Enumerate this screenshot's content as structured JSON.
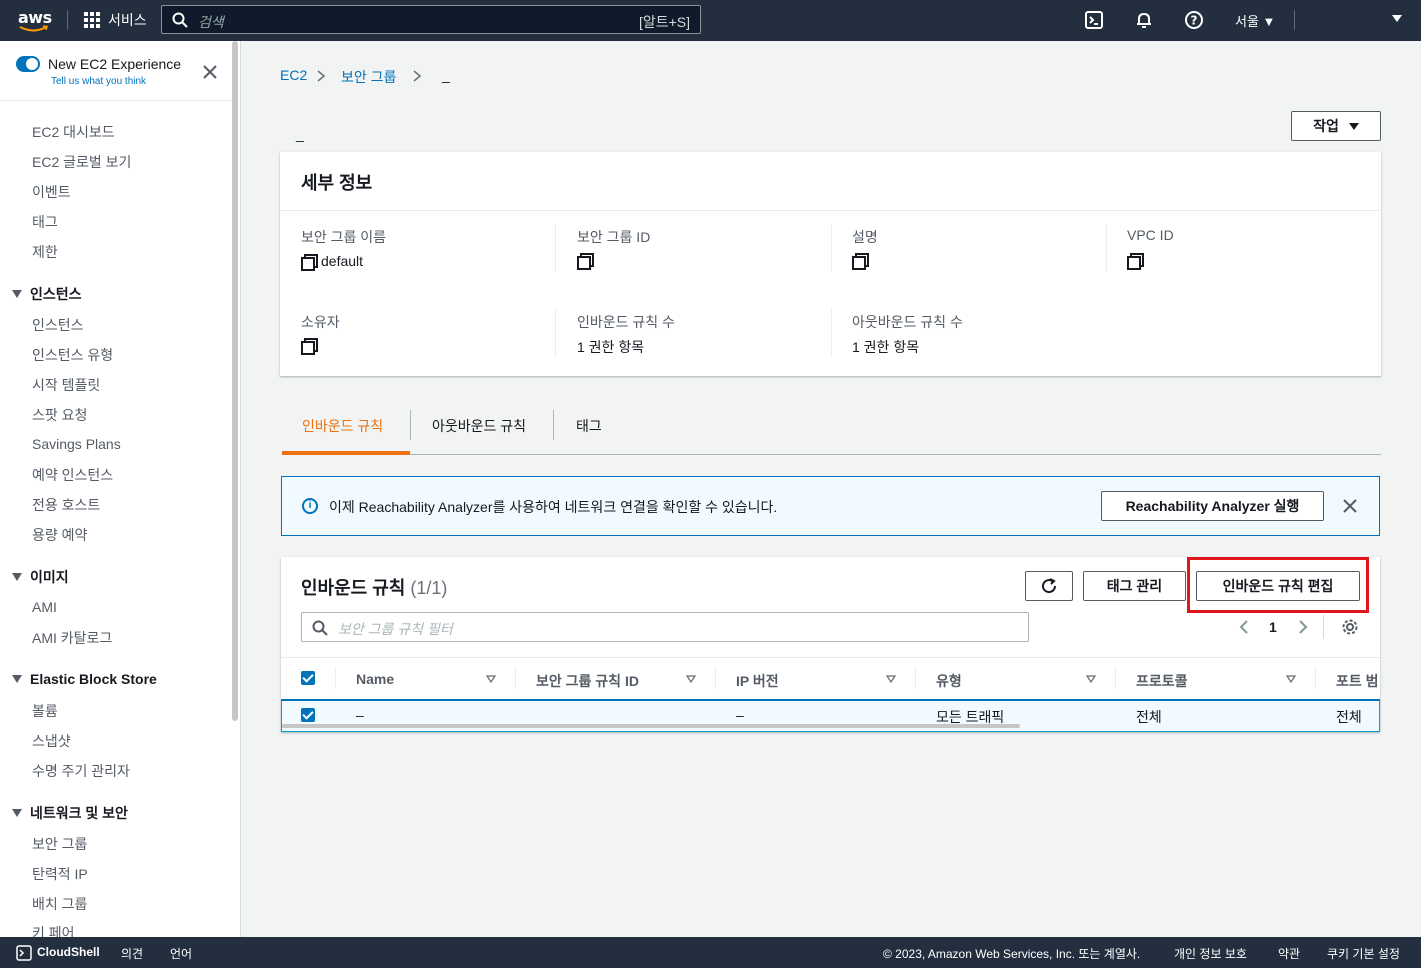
{
  "topnav": {
    "logo_text": "aws",
    "services_label": "서비스",
    "search_placeholder": "검색",
    "search_shortcut": "[알트+S]",
    "region": "서울",
    "colors": {
      "bg": "#232f3e",
      "accent": "#ec7211",
      "link": "#0073bb"
    }
  },
  "sidebar": {
    "experience_title": "New EC2 Experience",
    "experience_sub": "Tell us what you think",
    "top_items": [
      "EC2 대시보드",
      "EC2 글로벌 보기",
      "이벤트",
      "태그",
      "제한"
    ],
    "sections": [
      {
        "title": "인스턴스",
        "items": [
          "인스턴스",
          "인스턴스 유형",
          "시작 템플릿",
          "스팟 요청",
          "Savings Plans",
          "예약 인스턴스",
          "전용 호스트",
          "용량 예약"
        ]
      },
      {
        "title": "이미지",
        "items": [
          "AMI",
          "AMI 카탈로그"
        ]
      },
      {
        "title": "Elastic Block Store",
        "items": [
          "볼륨",
          "스냅샷",
          "수명 주기 관리자"
        ]
      },
      {
        "title": "네트워크 및 보안",
        "items": [
          "보안 그룹",
          "탄력적 IP",
          "배치 그룹",
          "키 페어"
        ]
      }
    ]
  },
  "breadcrumb": {
    "items": [
      "EC2",
      "보안 그룹",
      "_"
    ]
  },
  "page": {
    "title": "_",
    "actions_label": "작업"
  },
  "details": {
    "header": "세부 정보",
    "fields": {
      "sg_name_label": "보안 그룹 이름",
      "sg_name_value": "default",
      "sg_id_label": "보안 그룹 ID",
      "desc_label": "설명",
      "vpc_label": "VPC ID",
      "owner_label": "소유자",
      "inbound_count_label": "인바운드 규칙 수",
      "inbound_count_value": "1 권한 항목",
      "outbound_count_label": "아웃바운드 규칙 수",
      "outbound_count_value": "1 권한 항목"
    }
  },
  "tabs": [
    "인바운드 규칙",
    "아웃바운드 규칙",
    "태그"
  ],
  "alert": {
    "message": "이제 Reachability Analyzer를 사용하여 네트워크 연결을 확인할 수 있습니다.",
    "button": "Reachability Analyzer 실행"
  },
  "rules": {
    "title": "인바운드 규칙",
    "count": "(1/1)",
    "manage_tags": "태그 관리",
    "edit_rules": "인바운드 규칙 편집",
    "filter_placeholder": "보안 그룹 규칙 필터",
    "page": "1",
    "columns": [
      "Name",
      "보안 그룹 규칙 ID",
      "IP 버전",
      "유형",
      "프로토콜",
      "포트 범"
    ],
    "rows": [
      {
        "name": "–",
        "rule_id": "",
        "ip_version": "–",
        "type": "모든 트래픽",
        "protocol": "전체",
        "port": "전체"
      }
    ]
  },
  "footer": {
    "cloudshell": "CloudShell",
    "feedback": "의견",
    "language": "언어",
    "copyright": "© 2023, Amazon Web Services, Inc. 또는 계열사.",
    "privacy": "개인 정보 보호",
    "terms": "약관",
    "cookies": "쿠키 기본 설정"
  }
}
